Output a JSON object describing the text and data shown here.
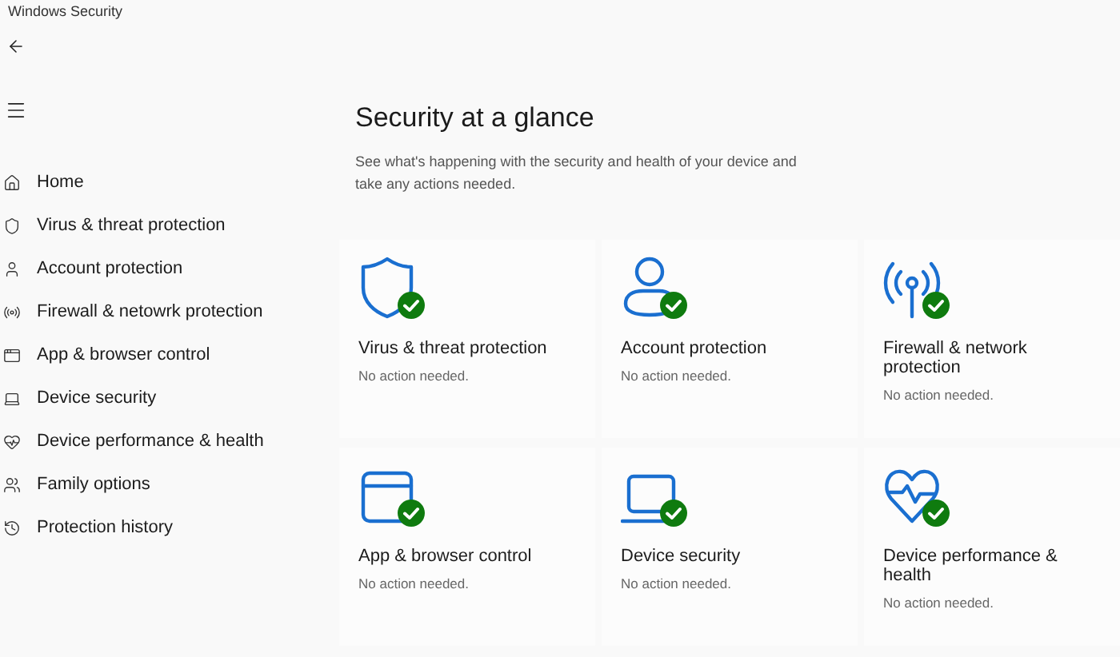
{
  "window": {
    "title": "Windows Security"
  },
  "sidebar": {
    "items": [
      {
        "label": "Home",
        "selected": false
      },
      {
        "label": "Virus & threat protection",
        "selected": false
      },
      {
        "label": "Account protection",
        "selected": false
      },
      {
        "label": "Firewall & netowrk protection",
        "selected": false
      },
      {
        "label": "App & browser control",
        "selected": false
      },
      {
        "label": "Device security",
        "selected": false
      },
      {
        "label": "Device performance & health",
        "selected": false
      },
      {
        "label": "Family options",
        "selected": false
      },
      {
        "label": "Protection history",
        "selected": false
      }
    ]
  },
  "main": {
    "title": "Security at a glance",
    "description": "See what's happening with the security and health of your device and take any actions needed.",
    "cards": [
      {
        "title": "Virus & threat protection",
        "protected": true,
        "message": "No action needed."
      },
      {
        "title": "Account protection",
        "protected": true,
        "message": "No action needed."
      },
      {
        "title": "Firewall & network protection",
        "protected": true,
        "message": "No action needed."
      },
      {
        "title": "App & browser control",
        "protected": true,
        "message": "No action needed."
      },
      {
        "title": "Device security",
        "protected": true,
        "message": "No action needed."
      },
      {
        "title": "Device performance & health",
        "protected": true,
        "message": "No action needed."
      }
    ]
  }
}
